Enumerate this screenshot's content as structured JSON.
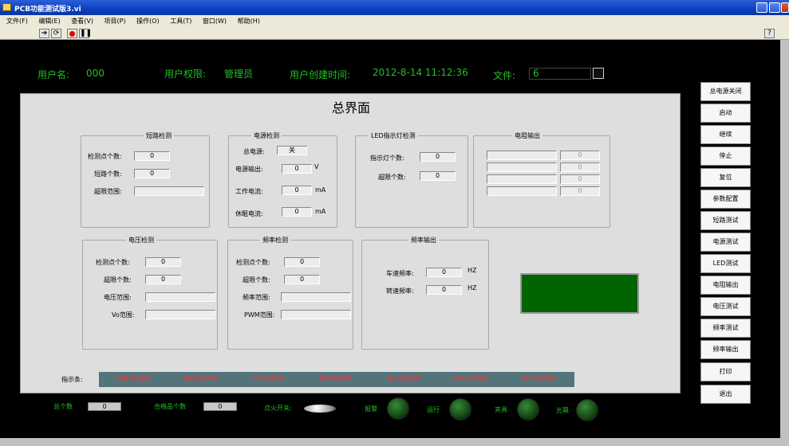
{
  "window": {
    "title": "PCB功能测试版3.vi"
  },
  "menu": [
    "文件(F)",
    "编辑(E)",
    "查看(V)",
    "项目(P)",
    "操作(O)",
    "工具(T)",
    "窗口(W)",
    "帮助(H)"
  ],
  "header": {
    "user_label": "用户名:",
    "user_value": "000",
    "perm_label": "用户权限:",
    "perm_value": "管理员",
    "time_label": "用户创建时间:",
    "time_value": "2012-8-14  11:12:36",
    "file_label": "文件:",
    "file_value": "6"
  },
  "main_title": "总界面",
  "short": {
    "title": "短路检测",
    "points_label": "检测点个数:",
    "points": "0",
    "count_label": "短路个数:",
    "count": "0",
    "range_label": "超限范围:",
    "range": ""
  },
  "power": {
    "title": "电源检测",
    "main_label": "总电源:",
    "main": "关",
    "out_label": "电源输出:",
    "out": "0",
    "out_unit": "V",
    "work_label": "工作电流:",
    "work": "0",
    "work_unit": "mA",
    "sleep_label": "休眠电流:",
    "sleep": "0",
    "sleep_unit": "mA"
  },
  "led": {
    "title": "LED指示灯检测",
    "count_label": "指示灯个数:",
    "count": "0",
    "over_label": "超限个数:",
    "over": "0"
  },
  "res": {
    "title": "电阻输出",
    "values": [
      "0",
      "0",
      "0",
      "0"
    ]
  },
  "volt": {
    "title": "电压检测",
    "points_label": "检测点个数:",
    "points": "0",
    "over_label": "超限个数:",
    "over": "0",
    "range_label": "电压范围:",
    "range": "",
    "vo_label": "Vo范围:",
    "vo": ""
  },
  "freq": {
    "title": "频率检测",
    "points_label": "检测点个数:",
    "points": "0",
    "over_label": "超限个数:",
    "over": "0",
    "range_label": "频率范围:",
    "range": "",
    "pwm_label": "PWM范围:",
    "pwm": ""
  },
  "fout": {
    "title": "频率输出",
    "car_label": "车速频率:",
    "car": "0",
    "car_unit": "HZ",
    "rot_label": "转速频率:",
    "rot": "0",
    "rot_unit": "HZ"
  },
  "indicator": {
    "label": "指示条:",
    "items": [
      "短路测试完成",
      "电源测试完成",
      "LED测试完成",
      "电阻输出完成",
      "电压测试完成",
      "频率测试完成",
      "频率输出完成"
    ]
  },
  "buttons": [
    "总电源关闭",
    "启动",
    "继续",
    "停止",
    "复位",
    "参数配置",
    "短路测试",
    "电源测试",
    "LED测试",
    "电阻输出",
    "电压测试",
    "频率测试",
    "频率输出",
    "打印",
    "退出"
  ],
  "bottom": {
    "total_label": "总个数",
    "total": "0",
    "pass_label": "合格品个数",
    "pass": "0",
    "fire_label": "点火开关:",
    "alarm_label": "报警",
    "run_label": "运行",
    "fixture_label": "夹具",
    "curtain_label": "光幕"
  },
  "colors": {
    "accent_green": "#20c020",
    "indicator_red": "#ff3030",
    "display_green": "#006400"
  }
}
